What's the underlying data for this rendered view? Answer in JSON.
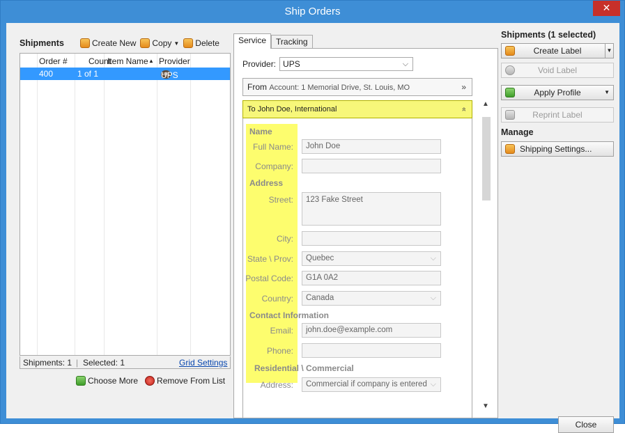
{
  "window": {
    "title": "Ship Orders",
    "close_glyph": "✕"
  },
  "shipments": {
    "title": "Shipments",
    "toolbar": {
      "create_new": "Create New",
      "copy": "Copy",
      "delete": "Delete"
    },
    "columns": [
      "Order #",
      "Count",
      "Item Name",
      "Provider"
    ],
    "sort_indicator": "▲",
    "rows": [
      {
        "order": "400",
        "count": "1 of 1",
        "item_name": "",
        "provider": "UPS",
        "provider_badge": "ups"
      }
    ],
    "status": {
      "shipments": "Shipments: 1",
      "selected": "Selected: 1",
      "grid_settings": "Grid Settings"
    },
    "choose_more": "Choose More",
    "remove_from_list": "Remove From List"
  },
  "tabs": {
    "service": "Service",
    "tracking": "Tracking"
  },
  "service": {
    "provider_label": "Provider:",
    "provider_value": "UPS",
    "from": {
      "label": "From",
      "account": "Account: 1 Memorial Drive, St. Louis, MO"
    },
    "to": {
      "label": "To",
      "summary": "John Doe, International"
    },
    "form": {
      "name_group": "Name",
      "full_name_label": "Full Name:",
      "full_name": "John Doe",
      "company_label": "Company:",
      "company": "",
      "address_group": "Address",
      "street_label": "Street:",
      "street": "123 Fake Street",
      "city_label": "City:",
      "city": "",
      "state_label": "State \\ Prov:",
      "state": "Quebec",
      "postal_label": "Postal Code:",
      "postal": "G1A 0A2",
      "country_label": "Country:",
      "country": "Canada",
      "contact_group": "Contact Information",
      "email_label": "Email:",
      "email": "john.doe@example.com",
      "phone_label": "Phone:",
      "phone": "",
      "residential_group": "Residential \\ Commercial",
      "address_type_label": "Address:",
      "address_type": "Commercial if company is entered"
    }
  },
  "right": {
    "shipments_title": "Shipments (1 selected)",
    "create_label": "Create Label",
    "void_label": "Void Label",
    "apply_profile": "Apply Profile",
    "reprint_label": "Reprint Label",
    "manage_title": "Manage",
    "shipping_settings": "Shipping Settings..."
  },
  "footer": {
    "close": "Close"
  }
}
